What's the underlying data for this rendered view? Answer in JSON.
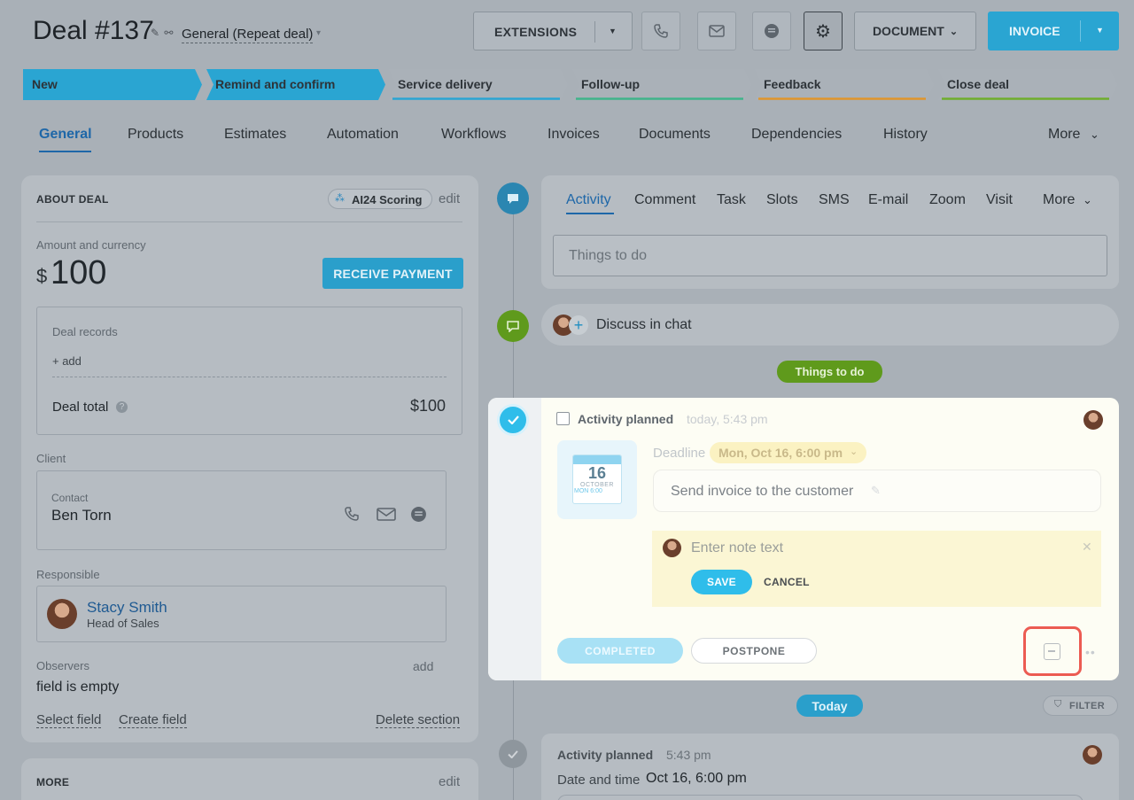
{
  "header": {
    "title": "Deal #137",
    "deal_type": "General (Repeat deal)",
    "extensions_label": "EXTENSIONS",
    "document_label": "DOCUMENT",
    "invoice_label": "INVOICE"
  },
  "stages": [
    {
      "label": "New",
      "color": "#2aa5d2",
      "active": true
    },
    {
      "label": "Remind and confirm",
      "color": "#2aa5d2",
      "active": true
    },
    {
      "label": "Service delivery",
      "color": "#2aa5d2",
      "active": false
    },
    {
      "label": "Follow-up",
      "color": "#3fb48a",
      "active": false
    },
    {
      "label": "Feedback",
      "color": "#e0962c",
      "active": false
    },
    {
      "label": "Close deal",
      "color": "#6fae2d",
      "active": false
    }
  ],
  "tabs": [
    "General",
    "Products",
    "Estimates",
    "Automation",
    "Workflows",
    "Invoices",
    "Documents",
    "Dependencies",
    "History",
    "More"
  ],
  "about": {
    "title": "ABOUT DEAL",
    "scoring": "AI24 Scoring",
    "edit": "edit",
    "amount_label": "Amount and currency",
    "currency": "$",
    "amount": "100",
    "receive_payment": "RECEIVE PAYMENT",
    "records_label": "Deal records",
    "add": "+ add",
    "total_label": "Deal total",
    "total_value": "$100",
    "client_label": "Client",
    "contact_label": "Contact",
    "contact_name": "Ben Torn",
    "responsible_label": "Responsible",
    "responsible_name": "Stacy Smith",
    "responsible_role": "Head of Sales",
    "observers_label": "Observers",
    "observers_add": "add",
    "observers_value": "field is empty",
    "select_field": "Select field",
    "create_field": "Create field",
    "delete_section": "Delete section"
  },
  "more_card": {
    "title": "MORE",
    "edit": "edit"
  },
  "timeline": {
    "tabs": [
      "Activity",
      "Comment",
      "Task",
      "Slots",
      "SMS",
      "E-mail",
      "Zoom",
      "Visit",
      "More"
    ],
    "input_placeholder": "Things to do",
    "discuss_chat": "Discuss in chat",
    "things_to_do_badge": "Things to do",
    "activity": {
      "title": "Activity planned",
      "time": "today, 5:43 pm",
      "cal_day": "16",
      "cal_month": "OCTOBER",
      "cal_sub": "MON 6:00",
      "deadline_label": "Deadline",
      "deadline_value": "Mon, Oct 16, 6:00 pm",
      "description": "Send invoice to the customer",
      "note_placeholder": "Enter note text",
      "save": "SAVE",
      "cancel": "CANCEL",
      "completed": "COMPLETED",
      "postpone": "POSTPONE"
    },
    "today_badge": "Today",
    "filter": "FILTER",
    "history_item": {
      "title": "Activity planned",
      "time": "5:43 pm",
      "date_label": "Date and time",
      "date_value": "Oct 16, 6:00 pm"
    }
  }
}
